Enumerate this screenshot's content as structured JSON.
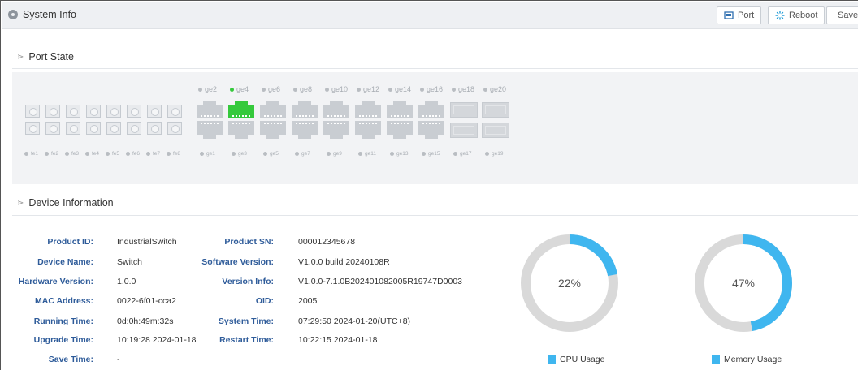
{
  "header": {
    "title": "System Info",
    "buttons": {
      "port": "Port",
      "reboot": "Reboot",
      "save": "Save"
    }
  },
  "port_state": {
    "title": "Port State",
    "fe_ports": [
      "fe1",
      "fe2",
      "fe3",
      "fe4",
      "fe5",
      "fe6",
      "fe7",
      "fe8"
    ],
    "ge_top": [
      "ge2",
      "ge4",
      "ge6",
      "ge8",
      "ge10",
      "ge12",
      "ge14",
      "ge16",
      "ge18",
      "ge20"
    ],
    "ge_bottom": [
      "ge1",
      "ge3",
      "ge5",
      "ge7",
      "ge9",
      "ge11",
      "ge13",
      "ge15",
      "ge17",
      "ge19"
    ],
    "active_port": "ge4",
    "colors": {
      "link_up": "#35c93c",
      "link_down": "#c9cdd2"
    }
  },
  "device_info": {
    "title": "Device Information",
    "left": [
      {
        "label": "Product ID:",
        "value": "IndustrialSwitch"
      },
      {
        "label": "Device Name:",
        "value": "Switch"
      },
      {
        "label": "Hardware Version:",
        "value": "1.0.0"
      },
      {
        "label": "MAC Address:",
        "value": "0022-6f01-cca2"
      },
      {
        "label": "Running Time:",
        "value": "0d:0h:49m:32s"
      },
      {
        "label": "Upgrade Time:",
        "value": "10:19:28 2024-01-18"
      },
      {
        "label": "Save Time:",
        "value": "-"
      }
    ],
    "right": [
      {
        "label": "Product SN:",
        "value": "000012345678"
      },
      {
        "label": "Software Version:",
        "value": "V1.0.0 build 20240108R"
      },
      {
        "label": "Version Info:",
        "value": "V1.0.0-7.1.0B202401082005R19747D0003"
      },
      {
        "label": "OID:",
        "value": "2005"
      },
      {
        "label": "System Time:",
        "value": "07:29:50 2024-01-20(UTC+8)"
      },
      {
        "label": "Restart Time:",
        "value": "10:22:15 2024-01-18"
      }
    ]
  },
  "usage": {
    "cpu": {
      "value": 22,
      "text": "22%",
      "label": "CPU Usage"
    },
    "memory": {
      "value": 47,
      "text": "47%",
      "label": "Memory Usage"
    },
    "colors": {
      "used": "#3fb6ef",
      "free": "#d9d9d9"
    }
  }
}
